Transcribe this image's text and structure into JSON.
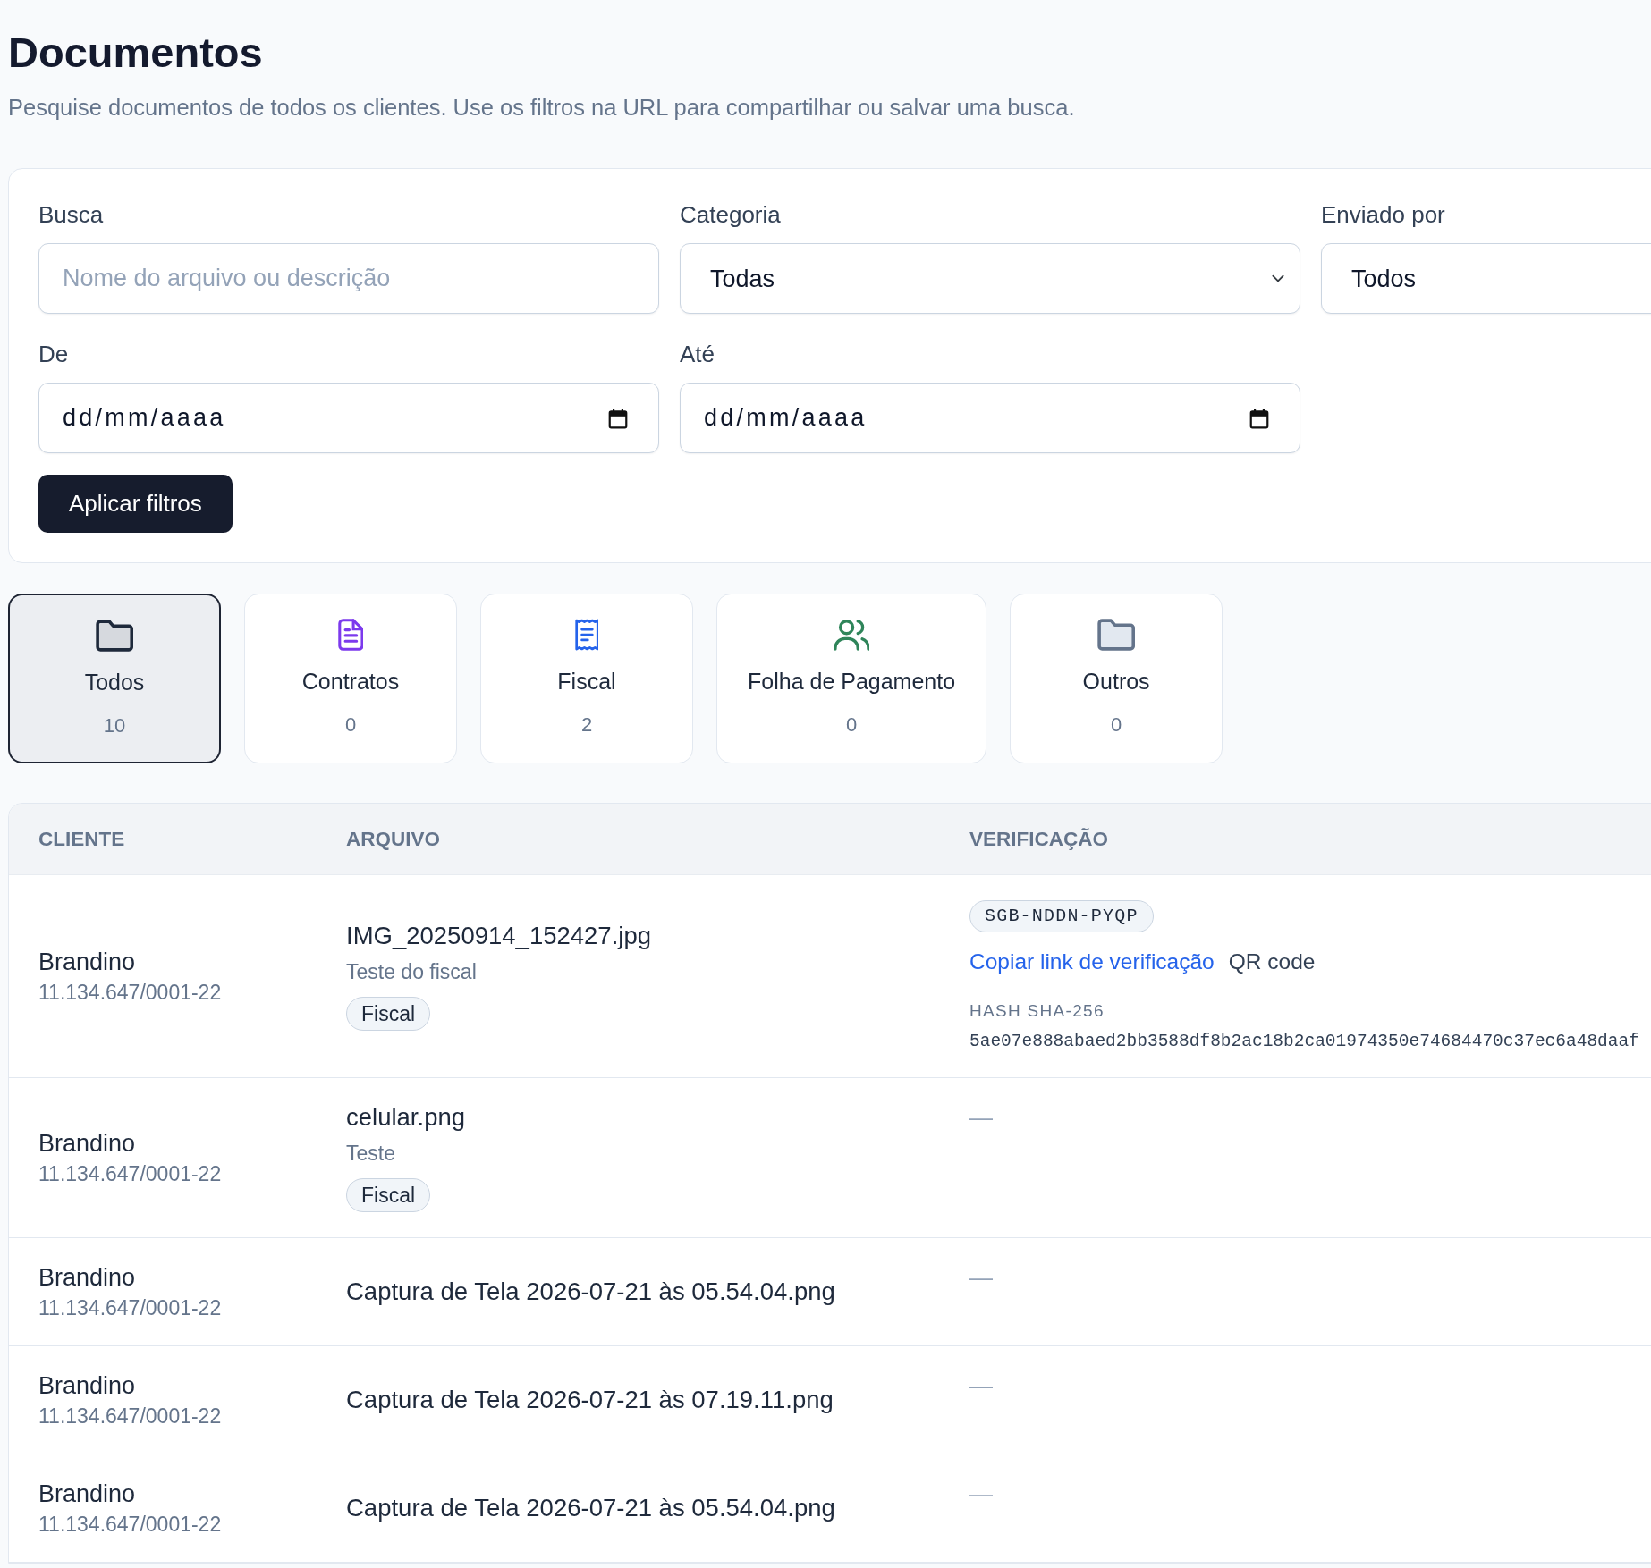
{
  "page": {
    "title": "Documentos",
    "subtitle": "Pesquise documentos de todos os clientes. Use os filtros na URL para compartilhar ou salvar uma busca."
  },
  "filters": {
    "fields": [
      {
        "kind": "text",
        "label": "Busca",
        "placeholder": "Nome do arquivo ou descrição"
      },
      {
        "kind": "select",
        "label": "Categoria",
        "value": "Todas"
      },
      {
        "kind": "select",
        "label": "Enviado por",
        "value": "Todos"
      },
      {
        "kind": "date",
        "label": "De",
        "placeholder": "dd/mm/aaaa"
      },
      {
        "kind": "date",
        "label": "Até",
        "placeholder": "dd/mm/aaaa"
      }
    ],
    "apply_button": "Aplicar filtros"
  },
  "categories": [
    {
      "kind": "all",
      "label": "Todos",
      "count": "10",
      "selected": true
    },
    {
      "kind": "contracts",
      "label": "Contratos",
      "count": "0",
      "selected": false
    },
    {
      "kind": "fiscal",
      "label": "Fiscal",
      "count": "2",
      "selected": false
    },
    {
      "kind": "payroll",
      "label": "Folha de Pagamento",
      "count": "0",
      "selected": false
    },
    {
      "kind": "other",
      "label": "Outros",
      "count": "0",
      "selected": false
    }
  ],
  "table": {
    "columns": [
      "CLIENTE",
      "ARQUIVO",
      "VERIFICAÇÃO"
    ],
    "rows": [
      {
        "client": "Brandino",
        "tax_id": "11.134.647/0001-22",
        "file": "IMG_20250914_152427.jpg",
        "description": "Teste do fiscal",
        "category": "Fiscal",
        "verification": {
          "kind": "details",
          "code": "SGB-NDDN-PYQP",
          "link": "Copiar link de verificação",
          "qr": "QR code",
          "hash_label": "HASH SHA-256",
          "hash": "5ae07e888abaed2bb3588df8b2ac18b2ca01974350e74684470c37ec6a48daaf"
        }
      },
      {
        "client": "Brandino",
        "tax_id": "11.134.647/0001-22",
        "file": "celular.png",
        "description": "Teste",
        "category": "Fiscal",
        "verification": {
          "kind": "none",
          "text": "—"
        }
      },
      {
        "client": "Brandino",
        "tax_id": "11.134.647/0001-22",
        "file": "Captura de Tela 2026-07-21 às 05.54.04.png",
        "verification": {
          "kind": "none",
          "text": "—"
        }
      },
      {
        "client": "Brandino",
        "tax_id": "11.134.647/0001-22",
        "file": "Captura de Tela 2026-07-21 às 07.19.11.png",
        "verification": {
          "kind": "none",
          "text": "—"
        }
      },
      {
        "client": "Brandino",
        "tax_id": "11.134.647/0001-22",
        "file": "Captura de Tela 2026-07-21 às 05.54.04.png",
        "verification": {
          "kind": "none",
          "text": "—"
        }
      }
    ]
  }
}
